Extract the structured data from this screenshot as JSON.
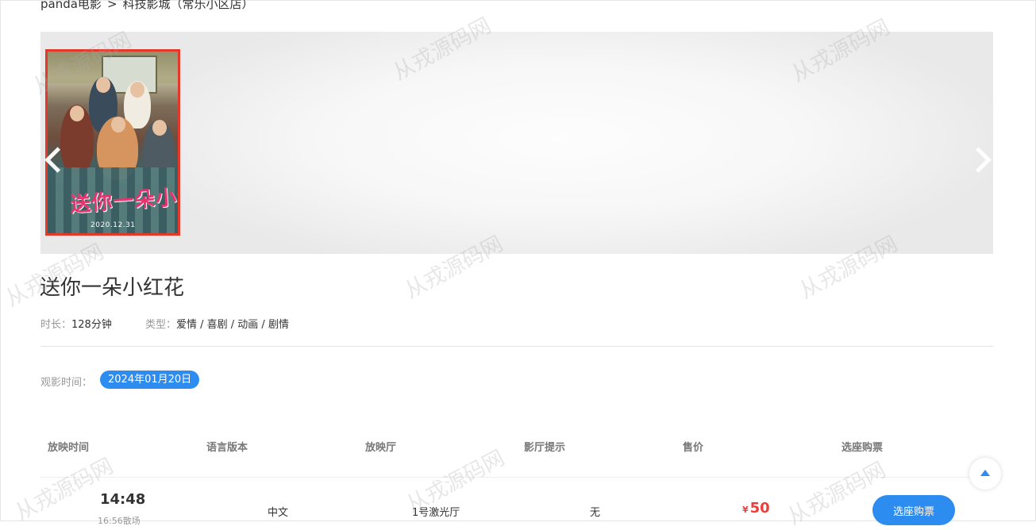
{
  "breadcrumb": {
    "site": "panda电影",
    "separator": ">",
    "cinema": "科技影城（常乐小区店）"
  },
  "banner": {
    "poster": {
      "title_art": "送你一朵小红花",
      "date": "2020.12.31"
    },
    "icons": {
      "prev": "chevron-left-icon",
      "next": "chevron-right-icon"
    }
  },
  "movie": {
    "title": "送你一朵小红花",
    "duration_label": "时长：",
    "duration_value": "128分钟",
    "genre_label": "类型：",
    "genre_value": "爱情 / 喜剧 / 动画 / 剧情"
  },
  "watch": {
    "label": "观影时间：",
    "date": "2024年01月20日"
  },
  "table": {
    "headers": [
      "放映时间",
      "语言版本",
      "放映厅",
      "影厅提示",
      "售价",
      "选座购票"
    ],
    "rows": [
      {
        "start": "14:48",
        "end": "16:56散场",
        "language": "中文",
        "hall": "1号激光厅",
        "tip": "无",
        "currency": "¥",
        "price": "50",
        "action": "选座购票"
      }
    ]
  },
  "watermark": "从戎源码网",
  "colors": {
    "accent": "#2d8cf0",
    "price": "#f03d37",
    "poster_border": "#e4392a"
  },
  "icons": {
    "back_to_top": "arrow-up-icon"
  }
}
